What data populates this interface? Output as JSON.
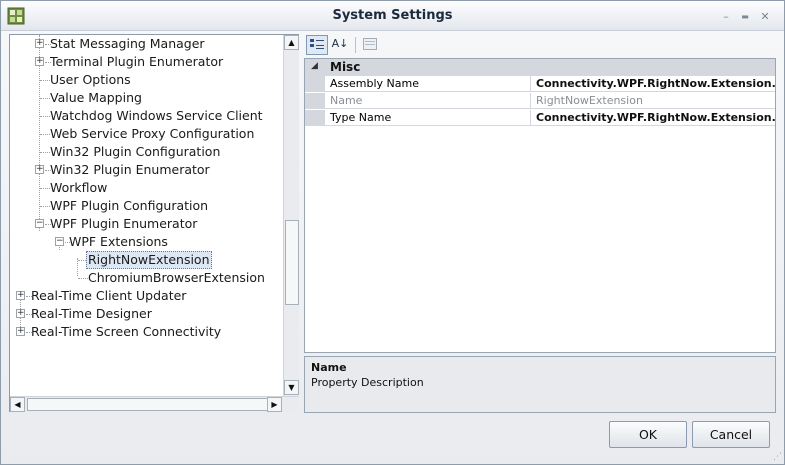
{
  "window": {
    "title": "System Settings",
    "controls": {
      "minimize": "–",
      "maximize": "▬",
      "close": "✕"
    }
  },
  "tree": {
    "items": [
      {
        "label": "Stat Messaging Manager",
        "expander": "+"
      },
      {
        "label": "Terminal Plugin Enumerator",
        "expander": "+"
      },
      {
        "label": "User Options",
        "expander": ""
      },
      {
        "label": "Value Mapping",
        "expander": ""
      },
      {
        "label": "Watchdog Windows Service Client",
        "expander": ""
      },
      {
        "label": "Web Service Proxy Configuration",
        "expander": ""
      },
      {
        "label": "Win32 Plugin Configuration",
        "expander": ""
      },
      {
        "label": "Win32 Plugin Enumerator",
        "expander": "+"
      },
      {
        "label": "Workflow",
        "expander": ""
      },
      {
        "label": "WPF Plugin Configuration",
        "expander": ""
      },
      {
        "label": "WPF Plugin Enumerator",
        "expander": "−"
      },
      {
        "label": "WPF Extensions",
        "expander": "−"
      },
      {
        "label": "RightNowExtension",
        "expander": "",
        "selected": true
      },
      {
        "label": "ChromiumBrowserExtension",
        "expander": ""
      },
      {
        "label": "Real-Time Client Updater",
        "expander": "+"
      },
      {
        "label": "Real-Time Designer",
        "expander": "+"
      },
      {
        "label": "Real-Time Screen Connectivity",
        "expander": "+"
      }
    ],
    "scroll": {
      "up": "▲",
      "down": "▼",
      "left": "◀",
      "right": "▶"
    }
  },
  "toolbar": {
    "categorized_icon": "categorized-icon",
    "alphabetical_icon": "sort-alpha-icon",
    "alphabetical_glyph": "A↓",
    "pages_icon": "property-pages-icon"
  },
  "grid": {
    "category": "Misc",
    "category_toggle": "◢",
    "rows": [
      {
        "name": "Assembly Name",
        "value": "Connectivity.WPF.RightNow.Extension.dll"
      },
      {
        "name": "Name",
        "value": "RightNowExtension"
      },
      {
        "name": "Type Name",
        "value": "Connectivity.WPF.RightNow.Extension.RightNowExtension"
      }
    ]
  },
  "description": {
    "title": "Name",
    "text": "Property Description"
  },
  "buttons": {
    "ok": "OK",
    "cancel": "Cancel"
  }
}
